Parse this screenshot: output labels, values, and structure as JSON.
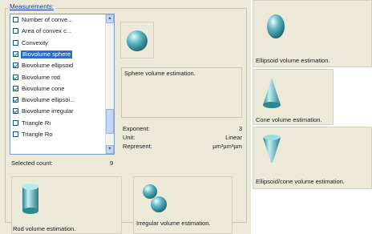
{
  "measurements": {
    "group_title": "Measurements:",
    "items": [
      {
        "label": "Number of conve...",
        "checked": false,
        "selected": false
      },
      {
        "label": "Area of convex c...",
        "checked": false,
        "selected": false
      },
      {
        "label": "Convexity",
        "checked": false,
        "selected": false
      },
      {
        "label": "Biovolume sphere",
        "checked": true,
        "selected": true
      },
      {
        "label": "Biovolume ellipsoid",
        "checked": true,
        "selected": false
      },
      {
        "label": "Biovolume rod",
        "checked": true,
        "selected": false
      },
      {
        "label": "Biovolume cone",
        "checked": true,
        "selected": false
      },
      {
        "label": "Biovolume ellipsoi...",
        "checked": true,
        "selected": false
      },
      {
        "label": "Biovolume irregular",
        "checked": true,
        "selected": false
      },
      {
        "label": "Triangle Ri",
        "checked": false,
        "selected": false
      },
      {
        "label": "Triangle Ro",
        "checked": false,
        "selected": false
      }
    ],
    "selected_count_label": "Selected count:",
    "selected_count_value": "9"
  },
  "detail": {
    "description": "Sphere volume estimation.",
    "exponent_label": "Exponent:",
    "exponent_value": "3",
    "unit_label": "Unit:",
    "unit_value": "Linear",
    "represent_label": "Represent:",
    "represent_value": "µm³µm³µm"
  },
  "tiles": {
    "ellipsoid": "Ellipsoid volume estimation.",
    "cone": "Cone volume estimation.",
    "ellipsoid_cone": "Ellipsoid/cone volume estimation.",
    "rod": "Rod volume estimation.",
    "irregular": "Irregular volume estimation."
  },
  "colors": {
    "panel": "#ece9d8",
    "selection": "#316ac5",
    "shape_teal": "#3d9aa6"
  }
}
